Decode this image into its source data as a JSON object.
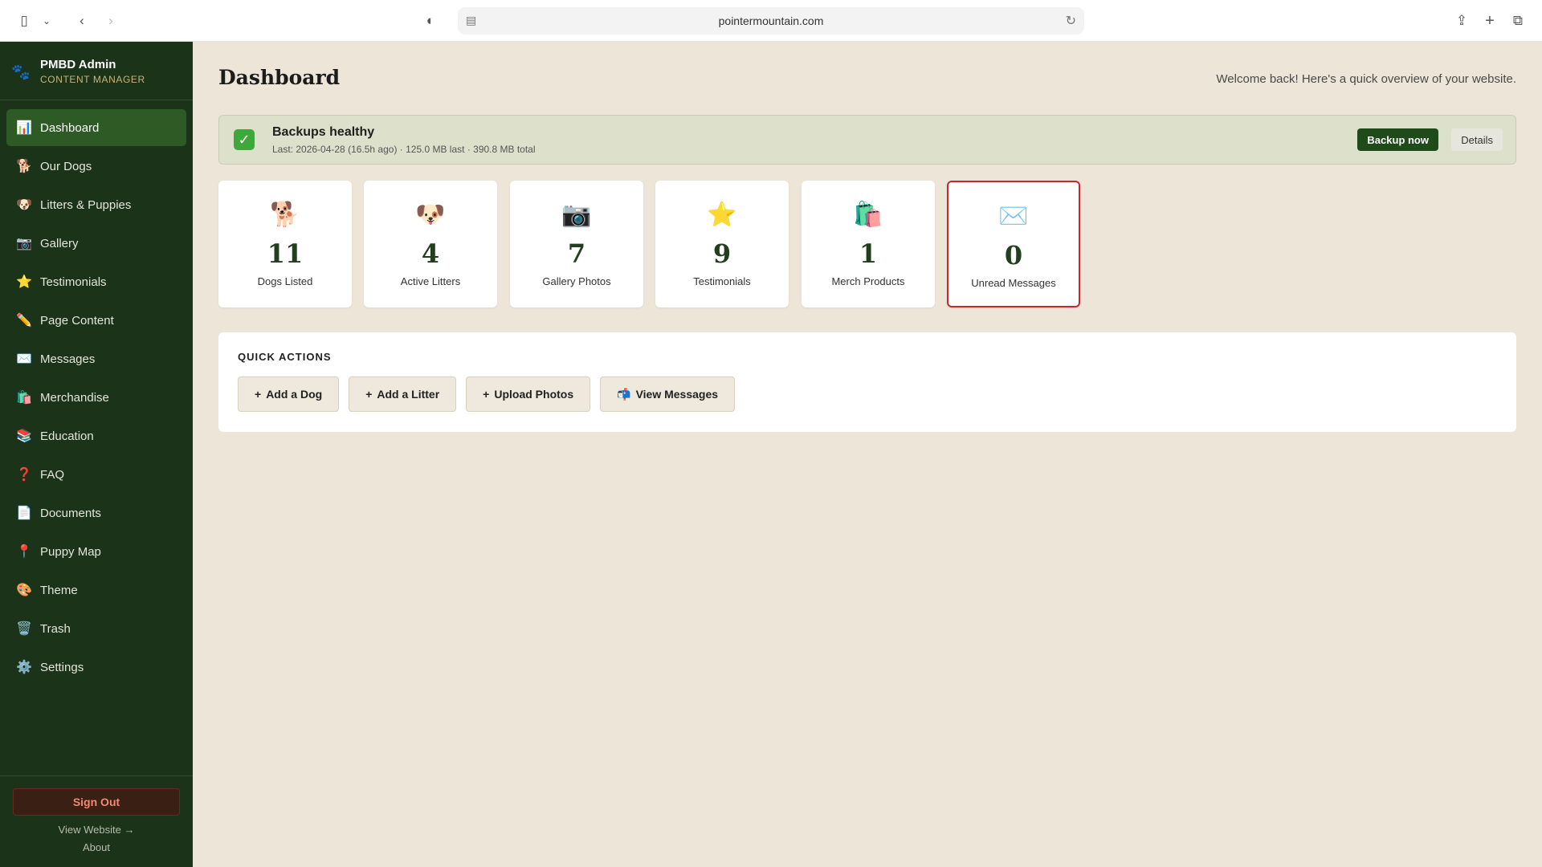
{
  "browser": {
    "url": "pointermountain.com"
  },
  "sidebar": {
    "brand_name": "PMBD Admin",
    "brand_sub": "CONTENT MANAGER",
    "items": [
      {
        "label": "Dashboard",
        "icon": "📊",
        "active": true
      },
      {
        "label": "Our Dogs",
        "icon": "🐕"
      },
      {
        "label": "Litters & Puppies",
        "icon": "🐶"
      },
      {
        "label": "Gallery",
        "icon": "📷"
      },
      {
        "label": "Testimonials",
        "icon": "⭐"
      },
      {
        "label": "Page Content",
        "icon": "✏️"
      },
      {
        "label": "Messages",
        "icon": "✉️"
      },
      {
        "label": "Merchandise",
        "icon": "🛍️"
      },
      {
        "label": "Education",
        "icon": "📚"
      },
      {
        "label": "FAQ",
        "icon": "❓"
      },
      {
        "label": "Documents",
        "icon": "📄"
      },
      {
        "label": "Puppy Map",
        "icon": "📍"
      },
      {
        "label": "Theme",
        "icon": "🎨"
      },
      {
        "label": "Trash",
        "icon": "🗑️"
      },
      {
        "label": "Settings",
        "icon": "⚙️"
      }
    ],
    "sign_out": "Sign Out",
    "view_website": "View Website →",
    "about": "About"
  },
  "main": {
    "title": "Dashboard",
    "welcome": "Welcome back! Here's a quick overview of your website.",
    "backup": {
      "title": "Backups healthy",
      "meta": "Last: 2026-04-28 (16.5h ago) · 125.0 MB last · 390.8 MB total",
      "backup_now": "Backup now",
      "details": "Details"
    },
    "stats": [
      {
        "icon": "🐕",
        "value": "11",
        "label": "Dogs Listed"
      },
      {
        "icon": "🐶",
        "value": "4",
        "label": "Active Litters"
      },
      {
        "icon": "📷",
        "value": "7",
        "label": "Gallery Photos"
      },
      {
        "icon": "⭐",
        "value": "9",
        "label": "Testimonials"
      },
      {
        "icon": "🛍️",
        "value": "1",
        "label": "Merch Products"
      },
      {
        "icon": "✉️",
        "value": "0",
        "label": "Unread Messages"
      }
    ],
    "quick_actions": {
      "header": "QUICK ACTIONS",
      "add_dog": "Add a Dog",
      "add_litter": "Add a Litter",
      "upload_photos": "Upload Photos",
      "view_messages": "View Messages",
      "plus": "+",
      "mailbox": "📬"
    }
  }
}
